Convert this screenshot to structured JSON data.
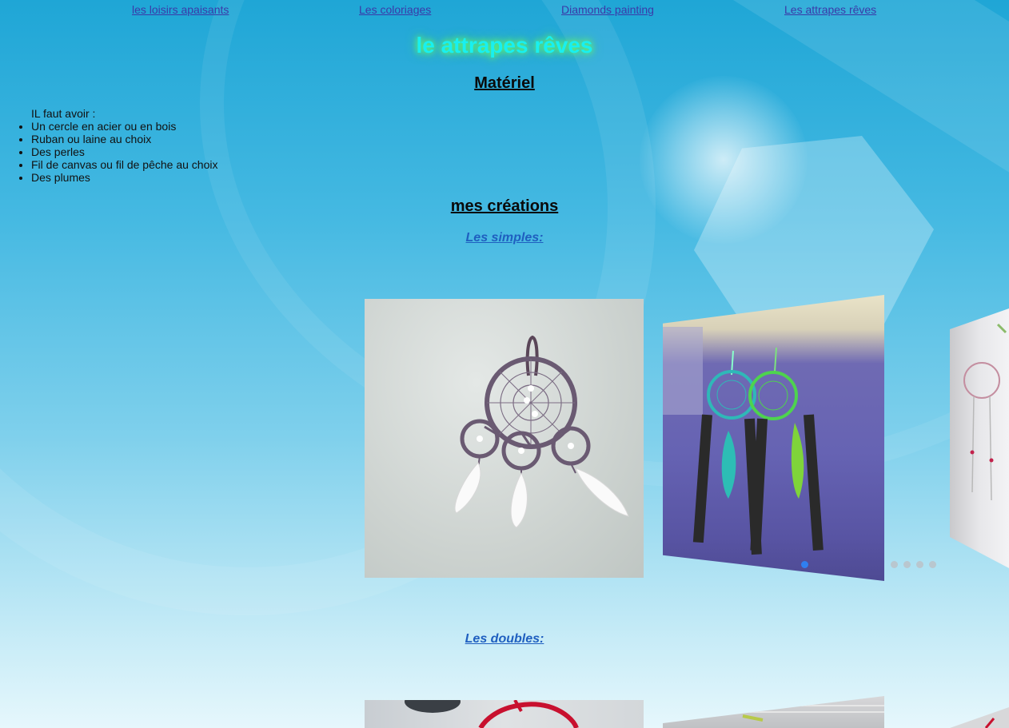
{
  "nav": {
    "links": [
      {
        "label": "les loisirs apaisants"
      },
      {
        "label": "Les coloriages"
      },
      {
        "label": "Diamonds painting"
      },
      {
        "label": "Les attrapes rêves"
      }
    ]
  },
  "page": {
    "title": "le attrapes rêves"
  },
  "material": {
    "heading": "Matériel",
    "intro": "IL faut avoir :",
    "items": [
      "Un cercle en acier ou en bois",
      "Ruban ou laine au choix",
      "Des perles",
      "Fil de canvas ou fil de pêche au choix",
      "Des plumes"
    ]
  },
  "creations": {
    "heading": "mes créations",
    "simples": "Les simples:",
    "doubles": "Les doubles:"
  },
  "carousel": {
    "dot_count": 6,
    "active_index": 0,
    "active_dot_color": "#2f7ff0",
    "dot_color": "#b9c7cf"
  },
  "colors": {
    "title_text": "#18f0f0",
    "title_glow": "#6cff6c",
    "link": "#3a3aa8",
    "subheading": "#1f5fc0"
  }
}
